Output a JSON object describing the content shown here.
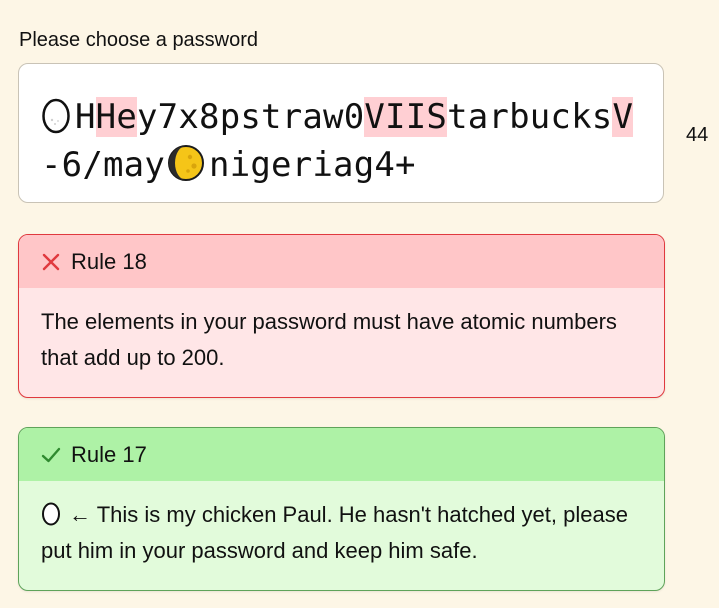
{
  "password_section": {
    "label": "Please choose a password",
    "segments": [
      {
        "text": "H",
        "highlight": false
      },
      {
        "text": "He",
        "highlight": true
      },
      {
        "text": "y7x8pstraw0",
        "highlight": false
      },
      {
        "text": "VIIS",
        "highlight": true
      },
      {
        "text": "tarbucks",
        "highlight": false
      },
      {
        "text": "V",
        "highlight": true
      },
      {
        "text": "-6/may",
        "highlight": false
      },
      {
        "text": "nigeriag4+",
        "highlight": false
      }
    ],
    "inline_icons": [
      "egg-icon",
      "moon-icon"
    ],
    "length_count": "44"
  },
  "rules": [
    {
      "status": "fail",
      "status_icon": "x-icon",
      "title": "Rule 18",
      "text": "The elements in your password must have atomic numbers that add up to 200."
    },
    {
      "status": "pass",
      "status_icon": "check-icon",
      "title": "Rule 17",
      "arrow": "←",
      "text": "This is my chicken Paul. He hasn't hatched yet, please put him in your password and keep him safe."
    }
  ],
  "colors": {
    "page_bg": "#fdf6e6",
    "highlight": "#ffcfd3",
    "fail_border": "#e0393e",
    "fail_header": "#ffc6c8",
    "fail_body": "#ffe6e7",
    "pass_border": "#5fa35a",
    "pass_header": "#aef2a6",
    "pass_body": "#e2fbdb"
  }
}
